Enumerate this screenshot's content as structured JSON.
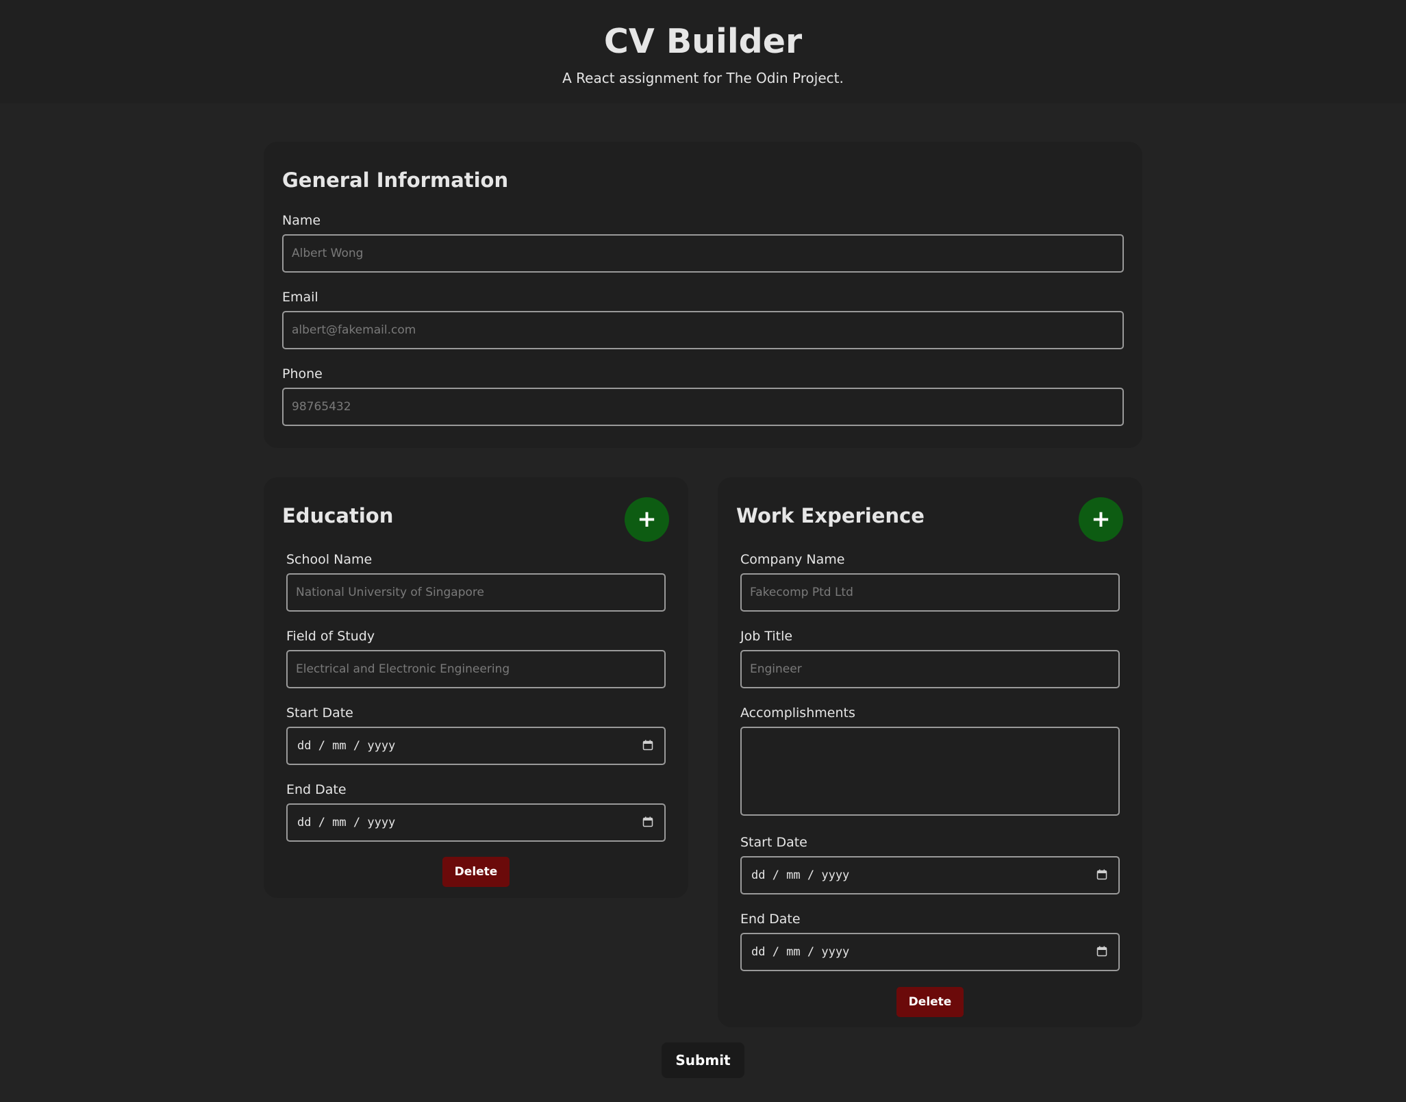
{
  "header": {
    "title": "CV Builder",
    "subtitle": "A React assignment for The Odin Project."
  },
  "general": {
    "title": "General Information",
    "name_label": "Name",
    "name_placeholder": "Albert Wong",
    "email_label": "Email",
    "email_placeholder": "albert@fakemail.com",
    "phone_label": "Phone",
    "phone_placeholder": "98765432"
  },
  "education": {
    "title": "Education",
    "add_label": "+",
    "school_label": "School Name",
    "school_placeholder": "National University of Singapore",
    "field_label": "Field of Study",
    "field_placeholder": "Electrical and Electronic Engineering",
    "start_label": "Start Date",
    "start_value": "dd / mm / yyyy",
    "end_label": "End Date",
    "end_value": "dd / mm / yyyy",
    "delete_label": "Delete"
  },
  "work": {
    "title": "Work Experience",
    "add_label": "+",
    "company_label": "Company Name",
    "company_placeholder": "Fakecomp Ptd Ltd",
    "job_label": "Job Title",
    "job_placeholder": "Engineer",
    "accomplishments_label": "Accomplishments",
    "accomplishments_value": "",
    "start_label": "Start Date",
    "start_value": "dd / mm / yyyy",
    "end_label": "End Date",
    "end_value": "dd / mm / yyyy",
    "delete_label": "Delete"
  },
  "submit_label": "Submit",
  "colors": {
    "background": "#232323",
    "card": "#1f1f1f",
    "add_button": "#0d5c12",
    "delete_button": "#6b0a0a",
    "submit_button": "#1a1a1a",
    "input_border": "#9a9a9a"
  },
  "icons": {
    "date_picker": "calendar-icon"
  }
}
